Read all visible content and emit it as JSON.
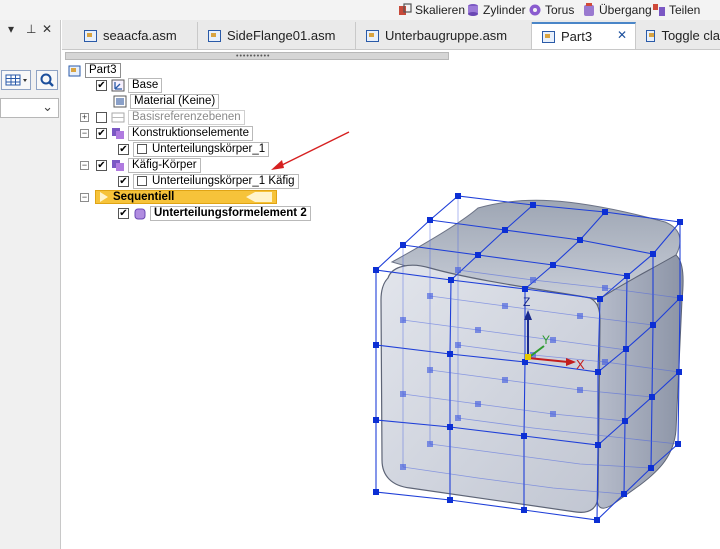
{
  "ribbon": {
    "items": [
      {
        "label": "Skalieren",
        "icon": "scale-icon"
      },
      {
        "label": "Zylinder",
        "icon": "cylinder-icon"
      },
      {
        "label": "Torus",
        "icon": "torus-icon"
      },
      {
        "label": "Übergang",
        "icon": "blend-icon"
      },
      {
        "label": "Teilen",
        "icon": "split-icon"
      }
    ]
  },
  "left_panel": {
    "dropdown_glyph": "▾",
    "pin_glyph": "⊥",
    "close_glyph": "✕",
    "combo_glyph": "⌄"
  },
  "tabs": [
    {
      "label": "seaacfa.asm",
      "active": false
    },
    {
      "label": "SideFlange01.asm",
      "active": false
    },
    {
      "label": "Unterbaugruppe.asm",
      "active": false
    },
    {
      "label": "Part3",
      "active": true,
      "close": "✕"
    },
    {
      "label": "Toggle cla",
      "active": false
    }
  ],
  "tree": {
    "root": "Part3",
    "items": [
      {
        "label": "Base",
        "checked": true
      },
      {
        "label": "Material (Keine)"
      },
      {
        "label": "Basisreferenzebenen",
        "checked": false,
        "expander": "+"
      },
      {
        "label": "Konstruktionselemente",
        "checked": true,
        "expander": "−"
      },
      {
        "label": "Unterteilungskörper_1",
        "checked": true
      },
      {
        "label": "Käfig-Körper",
        "checked": true,
        "expander": "−"
      },
      {
        "label": "Unterteilungskörper_1 Käfig",
        "checked": true
      },
      {
        "label": "Sequentiell",
        "expander": "−"
      },
      {
        "label": "Unterteilungsformelement 2",
        "checked": true
      }
    ],
    "check_glyph": "✔"
  },
  "axes": {
    "x": "X",
    "y": "Y",
    "z": "Z"
  },
  "colors": {
    "accent": "#4a86c8",
    "sequential_bg": "#f6c33a",
    "cage_edge": "#1f3fd8",
    "body_fill": "#b9bfcc",
    "annotation_arrow": "#d62020"
  }
}
